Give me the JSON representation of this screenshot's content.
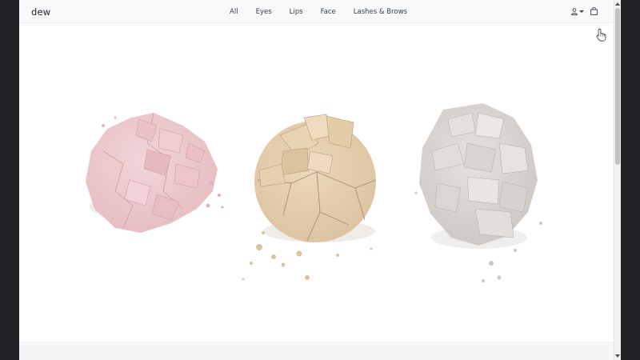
{
  "navbar": {
    "brand": "dew",
    "links": [
      "All",
      "Eyes",
      "Lips",
      "Face",
      "Lashes & Brows"
    ],
    "user_icon": "person-icon",
    "cart_icon": "shopping-bag-icon"
  },
  "hero": {
    "image": "three crushed powder compacts: pink, beige, grey",
    "colors": {
      "pink": "#ecc8cc",
      "beige": "#e6cfae",
      "grey": "#ddd8d5"
    }
  },
  "cursor": "pointer-hand-icon"
}
